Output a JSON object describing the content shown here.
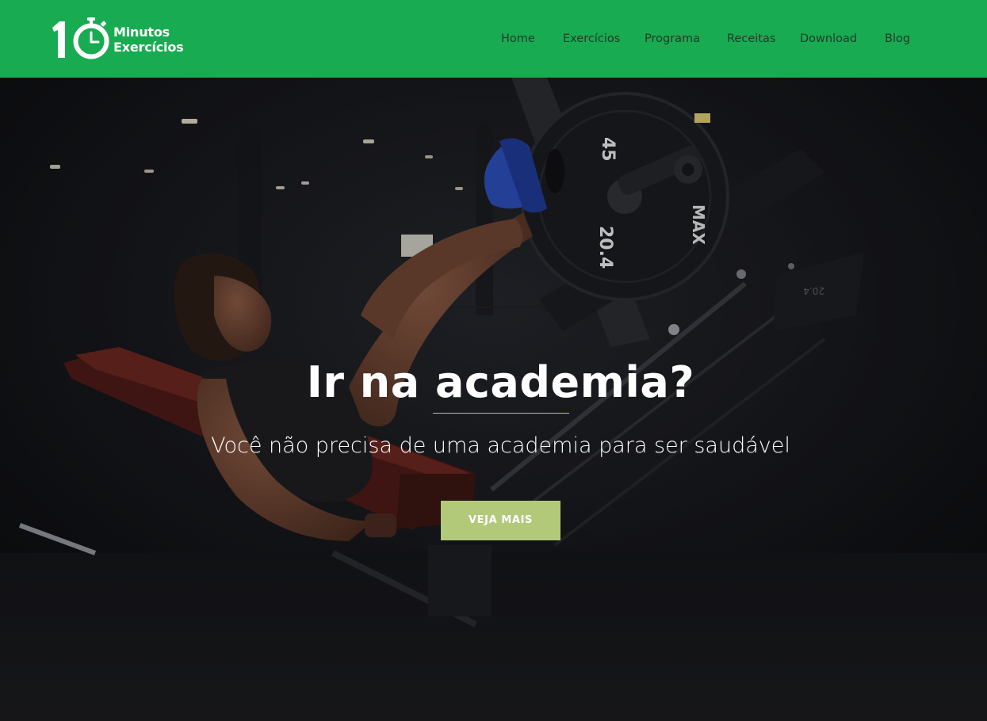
{
  "header": {
    "logo_number": "10",
    "logo_line1": "Minutos",
    "logo_line2": "Exercícios",
    "nav": [
      {
        "label": "Home"
      },
      {
        "label": "Exercícios"
      },
      {
        "label": "Programa"
      },
      {
        "label": "Receitas"
      },
      {
        "label": "Download"
      },
      {
        "label": "Blog"
      }
    ]
  },
  "hero": {
    "title": "Ir na academia?",
    "subtitle": "Você não precisa de uma academia para ser saudável",
    "button_label": "VEJA MAIS",
    "plate_weight": "45",
    "plate_kg": "20.4",
    "plate_brand": "MAX"
  },
  "colors": {
    "brand_green": "#19ab51",
    "accent_olive": "#b2c97a",
    "hero_bg": "#121318"
  }
}
